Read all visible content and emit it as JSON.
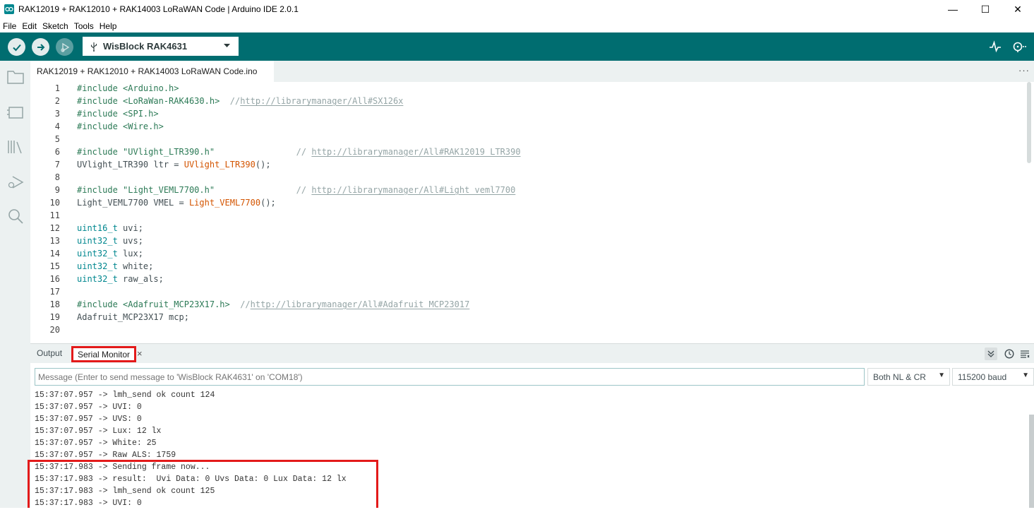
{
  "window": {
    "title": "RAK12019 + RAK12010 + RAK14003 LoRaWAN Code | Arduino IDE 2.0.1",
    "controls": {
      "minimize": "—",
      "maximize": "☐",
      "close": "✕"
    }
  },
  "menu": [
    "File",
    "Edit",
    "Sketch",
    "Tools",
    "Help"
  ],
  "toolbar": {
    "board": "WisBlock RAK4631",
    "icons": [
      "verify-icon",
      "upload-icon",
      "debug-icon",
      "serial-plotter-icon",
      "serial-monitor-icon"
    ]
  },
  "sidebar": {
    "icons": [
      "sketchbook-folder-icon",
      "boards-manager-icon",
      "library-manager-icon",
      "debug-icon",
      "search-icon"
    ]
  },
  "editor": {
    "tab_label": "RAK12019 + RAK12010 + RAK14003 LoRaWAN Code.ino",
    "more_label": "···",
    "lines": [
      {
        "n": "1",
        "segs": [
          [
            "g",
            "#include <Arduino.h>"
          ]
        ]
      },
      {
        "n": "2",
        "segs": [
          [
            "g",
            "#include <LoRaWan-RAK4630.h>"
          ],
          [
            "m",
            "  //"
          ],
          [
            "u",
            "http://librarymanager/All#SX126x"
          ]
        ]
      },
      {
        "n": "3",
        "segs": [
          [
            "g",
            "#include <SPI.h>"
          ]
        ]
      },
      {
        "n": "4",
        "segs": [
          [
            "g",
            "#include <Wire.h>"
          ]
        ]
      },
      {
        "n": "5",
        "segs": []
      },
      {
        "n": "6",
        "segs": [
          [
            "g",
            "#include \"UVlight_LTR390.h\""
          ],
          [
            "m",
            "                // "
          ],
          [
            "u",
            "http://librarymanager/All#RAK12019_LTR390"
          ]
        ]
      },
      {
        "n": "7",
        "segs": [
          [
            "d",
            "UVlight_LTR390 ltr = "
          ],
          [
            "o",
            "UVlight_LTR390"
          ],
          [
            "d",
            "();"
          ]
        ]
      },
      {
        "n": "8",
        "segs": []
      },
      {
        "n": "9",
        "segs": [
          [
            "g",
            "#include \"Light_VEML7700.h\""
          ],
          [
            "m",
            "                // "
          ],
          [
            "u",
            "http://librarymanager/All#Light_veml7700"
          ]
        ]
      },
      {
        "n": "10",
        "segs": [
          [
            "d",
            "Light_VEML7700 VMEL = "
          ],
          [
            "o",
            "Light_VEML7700"
          ],
          [
            "d",
            "();"
          ]
        ]
      },
      {
        "n": "11",
        "segs": []
      },
      {
        "n": "12",
        "segs": [
          [
            "t",
            "uint16_t"
          ],
          [
            "d",
            " uvi;"
          ]
        ]
      },
      {
        "n": "13",
        "segs": [
          [
            "t",
            "uint32_t"
          ],
          [
            "d",
            " uvs;"
          ]
        ]
      },
      {
        "n": "14",
        "segs": [
          [
            "t",
            "uint32_t"
          ],
          [
            "d",
            " lux;"
          ]
        ]
      },
      {
        "n": "15",
        "segs": [
          [
            "t",
            "uint32_t"
          ],
          [
            "d",
            " white;"
          ]
        ]
      },
      {
        "n": "16",
        "segs": [
          [
            "t",
            "uint32_t"
          ],
          [
            "d",
            " raw_als;"
          ]
        ]
      },
      {
        "n": "17",
        "segs": []
      },
      {
        "n": "18",
        "segs": [
          [
            "g",
            "#include <Adafruit_MCP23X17.h>"
          ],
          [
            "m",
            "  //"
          ],
          [
            "u",
            "http://librarymanager/All#Adafruit_MCP23017"
          ]
        ]
      },
      {
        "n": "19",
        "segs": [
          [
            "d",
            "Adafruit_MCP23X17 mcp;"
          ]
        ]
      },
      {
        "n": "20",
        "segs": []
      }
    ]
  },
  "panel": {
    "tab_output": "Output",
    "tab_serial": "Serial Monitor",
    "tab_close": "×",
    "message_placeholder": "Message (Enter to send message to 'WisBlock RAK4631' on 'COM18')",
    "line_ending": "Both NL & CR",
    "baud": "115200 baud",
    "serial_lines": [
      "15:37:07.957 -> lmh_send ok count 124",
      "15:37:07.957 -> UVI: 0",
      "15:37:07.957 -> UVS: 0",
      "15:37:07.957 -> Lux: 12 lx",
      "15:37:07.957 -> White: 25",
      "15:37:07.957 -> Raw ALS: 1759",
      "15:37:17.983 -> Sending frame now...",
      "15:37:17.983 -> result:  Uvi Data: 0 Uvs Data: 0 Lux Data: 12 lx",
      "15:37:17.983 -> lmh_send ok count 125",
      "15:37:17.983 -> UVI: 0"
    ]
  },
  "colors": {
    "toolbar": "#006d70",
    "accent": "#00878f",
    "highlight": "#e31a1a"
  }
}
